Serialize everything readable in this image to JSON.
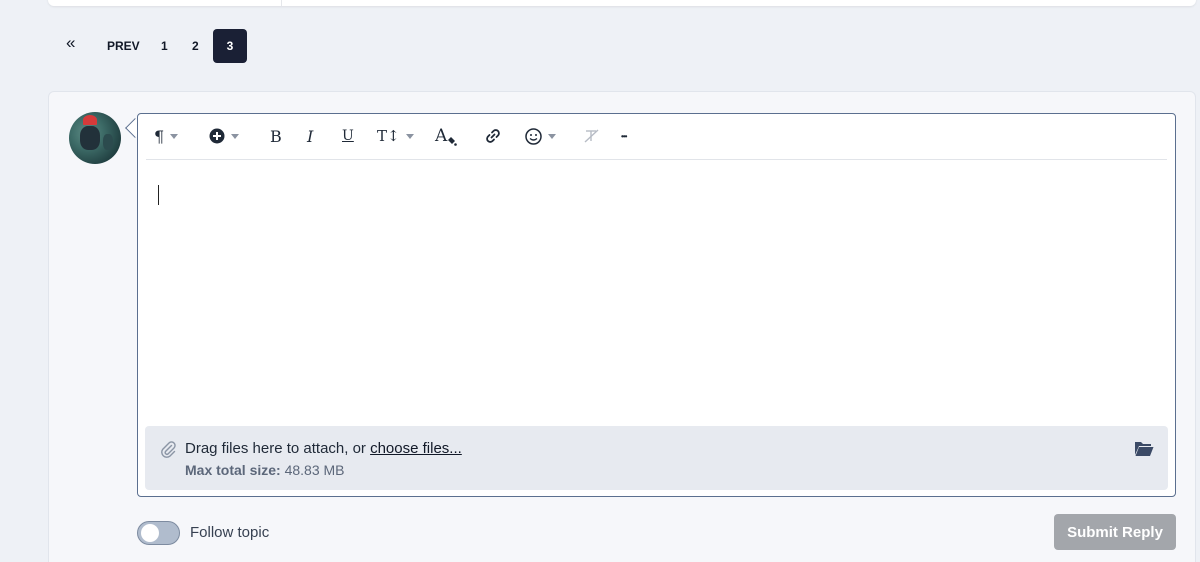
{
  "pagination": {
    "first_label": "«",
    "prev_label": "PREV",
    "pages": [
      "1",
      "2",
      "3"
    ],
    "current_page": "3"
  },
  "editor": {
    "toolbar": {
      "paragraph_icon": "paragraph-icon",
      "insert_icon": "plus-circle-icon",
      "bold_label": "B",
      "italic_label": "I",
      "underline_label": "U",
      "font_size_label": "T↕",
      "text_color_label": "A",
      "link_icon": "link-icon",
      "emoji_icon": "emoji-icon",
      "clear_format_icon": "clear-format-icon",
      "more_label": "•••"
    },
    "content": ""
  },
  "attachments": {
    "drag_text": "Drag files here to attach, or ",
    "choose_link": "choose files...",
    "max_size_label": "Max total size:",
    "max_size_value": " 48.83 MB"
  },
  "follow": {
    "label": "Follow topic",
    "enabled": false
  },
  "submit": {
    "label": "Submit Reply"
  },
  "colors": {
    "active_page_bg": "#1a2035",
    "editor_border": "#5b6f8f",
    "submit_bg": "#a3a6ab",
    "attach_bg": "#e7eaf0"
  }
}
